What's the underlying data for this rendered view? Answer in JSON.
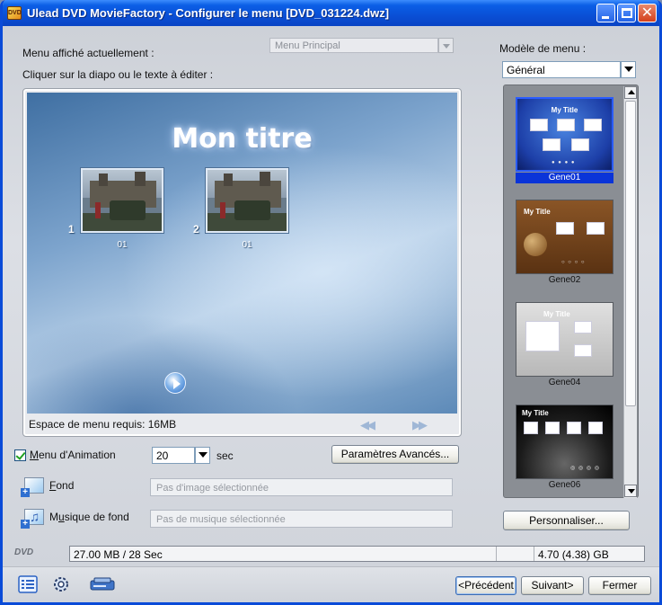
{
  "window": {
    "title": "Ulead DVD MovieFactory - Configurer le menu [DVD_031224.dwz]",
    "app_icon_text": "DVD",
    "title_color": "#0a4fd6"
  },
  "top": {
    "current_menu_label": "Menu affiché actuellement :",
    "current_menu_value": "Menu Principal",
    "edit_hint": "Cliquer sur la diapo ou le texte à éditer :"
  },
  "template_panel": {
    "label": "Modèle de menu :",
    "category": "Général",
    "templates": [
      {
        "title": "My Title",
        "caption": "Gene01",
        "selected": true
      },
      {
        "title": "My Title",
        "caption": "Gene02",
        "selected": false
      },
      {
        "title": "My Title",
        "caption": "Gene04",
        "selected": false
      },
      {
        "title": "My Title",
        "caption": "Gene06",
        "selected": false
      }
    ],
    "customize_button": "Personnaliser..."
  },
  "preview": {
    "menu_title": "Mon titre",
    "thumbnails": [
      {
        "number": "1",
        "caption": "01"
      },
      {
        "number": "2",
        "caption": "01"
      }
    ],
    "space_required": "Espace de menu requis: 16MB",
    "prev_glyph": "◀◀",
    "next_glyph": "▶▶"
  },
  "animation": {
    "checkbox_label": "Menu d'Animation",
    "checkbox_label_underline": "M",
    "checkbox_label_rest": "enu d'Animation",
    "checked": true,
    "duration_value": "20",
    "duration_unit": "sec",
    "advanced_button": "Paramètres Avancés..."
  },
  "background": {
    "label_underline": "F",
    "label_rest": "ond",
    "placeholder": "Pas d'image sélectionnée"
  },
  "music": {
    "label_first": "M",
    "label_underline": "u",
    "label_rest": "sique de fond",
    "placeholder": "Pas de musique sélectionnée"
  },
  "status": {
    "logo": "DVD",
    "used": "27.00 MB / 28 Sec",
    "capacity": "4.70 (4.38) GB"
  },
  "footer": {
    "prev_button": "<Précédent",
    "next_button": "Suivant>",
    "close_button": "Fermer",
    "icons": [
      "list-icon",
      "settings-gear-icon",
      "burn-drive-icon"
    ]
  }
}
